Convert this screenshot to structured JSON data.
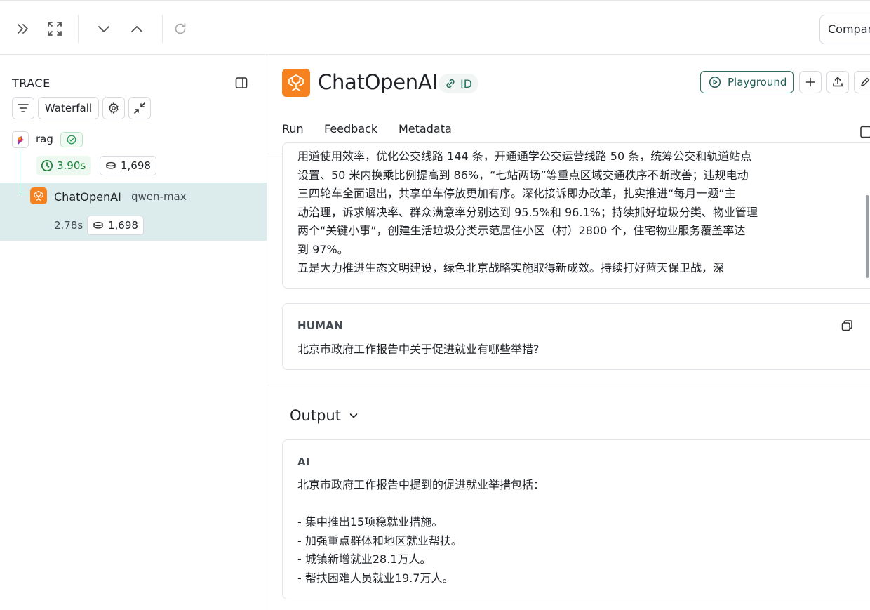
{
  "toolbar": {
    "compare_label": "Compar"
  },
  "trace_panel": {
    "title": "TRACE",
    "view_mode": "Waterfall",
    "root": {
      "name": "rag",
      "latency": "3.90s",
      "tokens": "1,698"
    },
    "child": {
      "name": "ChatOpenAI",
      "model": "qwen-max",
      "latency": "2.78s",
      "tokens": "1,698"
    }
  },
  "run": {
    "title": "ChatOpenAI",
    "id_label": "ID",
    "playground_label": "Playground",
    "tabs": [
      "Run",
      "Feedback",
      "Metadata"
    ],
    "active_tab": "Run",
    "input_message_text": "用道使用效率，优化公交线路 144 条，开通通学公交运营线路 50 条，统筹公交和轨道站点\n设置、50 米内换乘比例提高到 86%，“七站两场”等重点区域交通秩序不断改善；违规电动\n三四轮车全面退出，共享单车停放更加有序。深化接诉即办改革，扎实推进“每月一题”主\n动治理，诉求解决率、群众满意率分别达到 95.5%和 96.1%；持续抓好垃圾分类、物业管理\n两个“关键小事”，创建生活垃圾分类示范居住小区（村）2800 个，住宅物业服务覆盖率达\n到 97%。\n五是大力推进生态文明建设，绿色北京战略实施取得新成效。持续打好蓝天保卫战，深",
    "human": {
      "role": "HUMAN",
      "text": "北京市政府工作报告中关于促进就业有哪些举措?"
    },
    "output": {
      "header": "Output",
      "role": "AI",
      "text": "北京市政府工作报告中提到的促进就业举措包括：\n\n- 集中推出15项稳就业措施。\n- 加强重点群体和地区就业帮扶。\n- 城镇新增就业28.1万人。\n- 帮扶困难人员就业19.7万人。"
    }
  },
  "colors": {
    "accent_green": "#1a7f37",
    "openai_orange": "#f5821f",
    "selected_row": "#dcecec",
    "playground_border": "#2f6f63"
  }
}
